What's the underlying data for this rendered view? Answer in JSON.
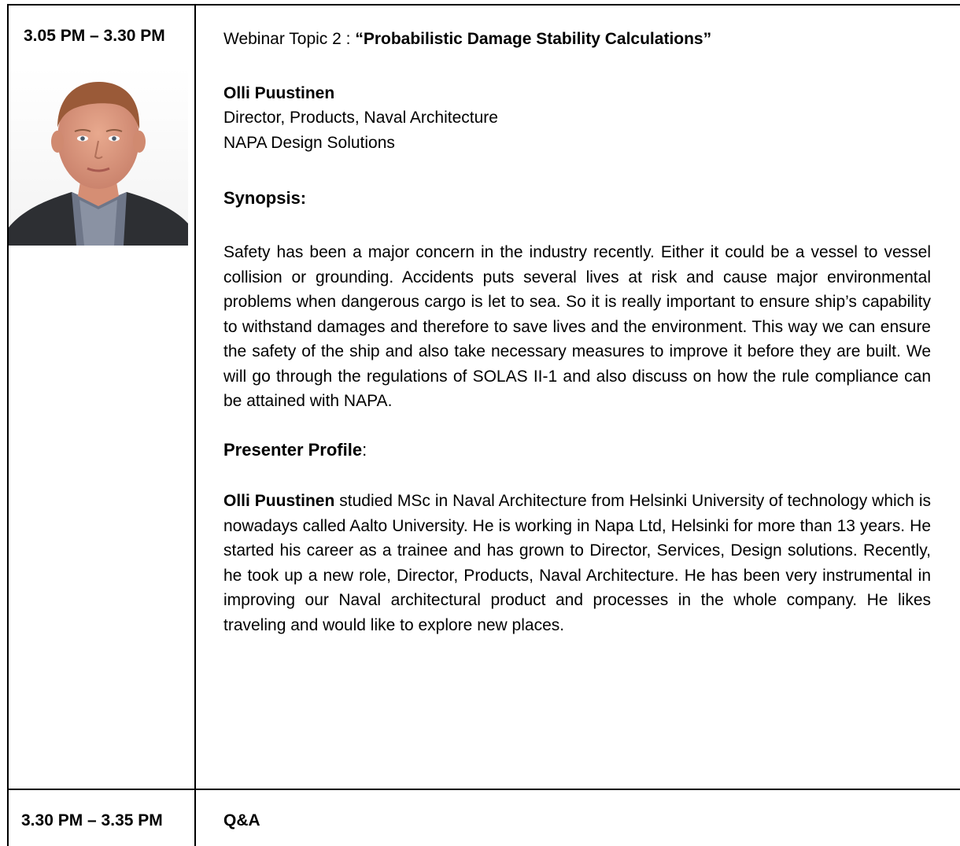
{
  "row1": {
    "time": "3.05 PM – 3.30 PM",
    "topic_prefix": "Webinar Topic 2 : ",
    "topic_title": "“Probabilistic Damage Stability Calculations”",
    "presenter": {
      "name": "Olli Puustinen",
      "role": "Director, Products, Naval Architecture",
      "org": "NAPA Design Solutions"
    },
    "synopsis_heading": "Synopsis:",
    "synopsis_text": "Safety has been a major concern in the industry recently. Either it could be a vessel to vessel collision or grounding. Accidents puts several lives at risk  and cause major environmental problems when dangerous cargo is let to sea. So it is really important to ensure ship’s capability to withstand damages and therefore to save lives and the environment. This way we can ensure the safety of the ship and also take necessary measures to improve it before they are built. We will go through the regulations of SOLAS II-1 and also discuss on how the rule compliance can be attained with NAPA.",
    "profile_heading": "Presenter Profile",
    "profile_heading_colon": ":",
    "profile_name": "Olli Puustinen",
    "profile_text": " studied MSc in Naval Architecture from Helsinki University of technology which is nowadays called Aalto University. He is working in Napa Ltd, Helsinki for more than 13 years. He started his career as a trainee and has grown to Director, Services, Design solutions. Recently, he took up a new role,  Director, Products, Naval Architecture.  He has been very instrumental in improving our Naval architectural product and processes in the whole company. He likes traveling and would like to explore new places."
  },
  "row2": {
    "time": "3.30 PM – 3.35 PM",
    "label": "Q&A"
  }
}
